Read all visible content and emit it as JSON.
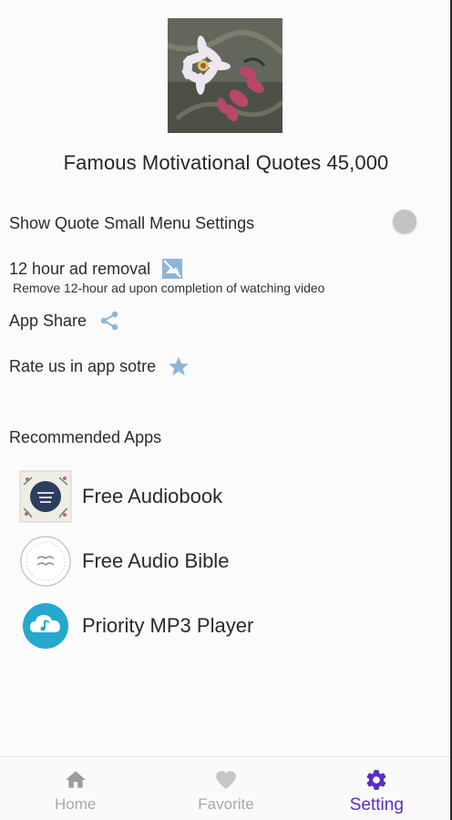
{
  "header": {
    "app_title": "Famous Motivational Quotes 45,000",
    "image_icon": "flower-photo"
  },
  "settings": {
    "small_menu": {
      "label": "Show Quote Small Menu Settings",
      "toggle_on": false,
      "icon": "toggle-switch"
    },
    "ad_removal": {
      "label": "12 hour ad removal",
      "subtitle": "Remove 12-hour ad upon completion of watching video",
      "icon": "ad-off-icon"
    },
    "share": {
      "label": "App Share",
      "icon": "share-icon"
    },
    "rate": {
      "label": "Rate us in app sotre",
      "icon": "star-icon"
    }
  },
  "recommended": {
    "title": "Recommended Apps",
    "apps": [
      {
        "name": "Free Audiobook",
        "icon": "audiobook-app-icon"
      },
      {
        "name": "Free Audio Bible",
        "icon": "audio-bible-app-icon"
      },
      {
        "name": "Priority MP3 Player",
        "icon": "mp3-player-app-icon"
      }
    ]
  },
  "bottom_nav": {
    "items": [
      {
        "label": "Home",
        "icon": "home-icon",
        "active": false
      },
      {
        "label": "Favorite",
        "icon": "heart-icon",
        "active": false
      },
      {
        "label": "Setting",
        "icon": "gear-icon",
        "active": true
      }
    ]
  },
  "colors": {
    "accent": "#5b2bc4",
    "icon_blue": "#8db4d9",
    "inactive_nav": "#a9a9a9",
    "mp3_icon_bg": "#25a8cc"
  }
}
